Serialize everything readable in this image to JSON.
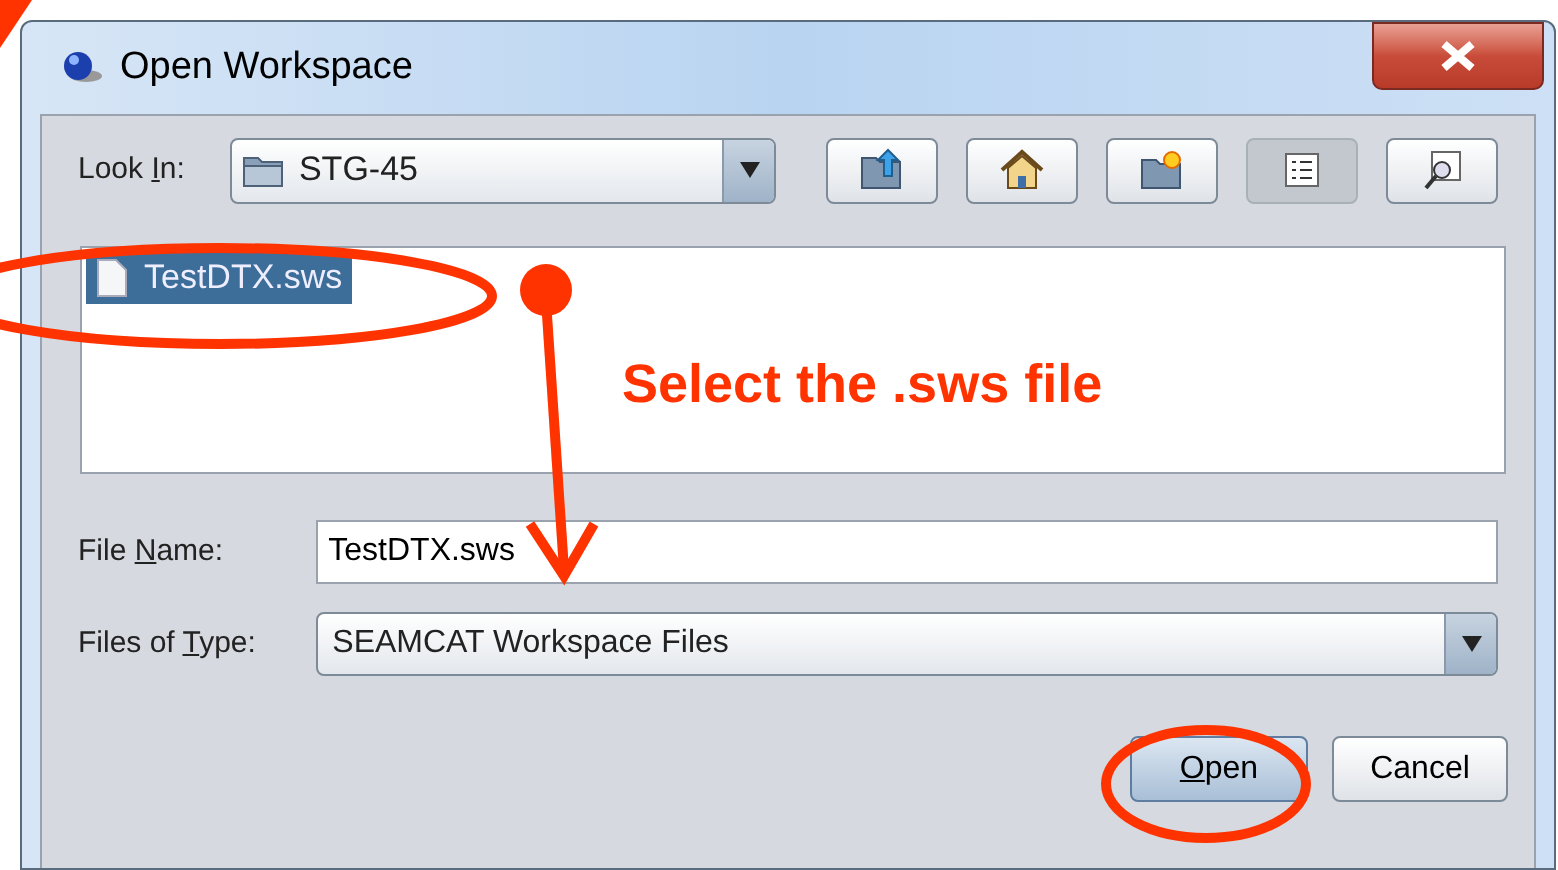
{
  "window": {
    "title": "Open Workspace"
  },
  "look_in": {
    "label": {
      "before": "Look ",
      "key": "I",
      "after": "n:"
    },
    "value": "STG-45"
  },
  "toolbar": [
    {
      "kind": "up"
    },
    {
      "kind": "home"
    },
    {
      "kind": "new-folder"
    },
    {
      "kind": "list",
      "selected": true
    },
    {
      "kind": "details",
      "selected": false
    }
  ],
  "files": [
    {
      "name": "TestDTX.sws",
      "selected": true
    }
  ],
  "file_name": {
    "label": {
      "before": "File ",
      "key": "N",
      "after": "ame:"
    },
    "value": "TestDTX.sws"
  },
  "file_type": {
    "label": {
      "before": "Files of ",
      "key": "T",
      "after": "ype:"
    },
    "value": "SEAMCAT Workspace Files"
  },
  "buttons": [
    {
      "label": {
        "key": "O",
        "after": "pen"
      },
      "kind": "default"
    },
    {
      "label": {
        "before": "Cancel"
      },
      "kind": "normal"
    }
  ],
  "annotation": {
    "text": "Select the .sws file"
  }
}
